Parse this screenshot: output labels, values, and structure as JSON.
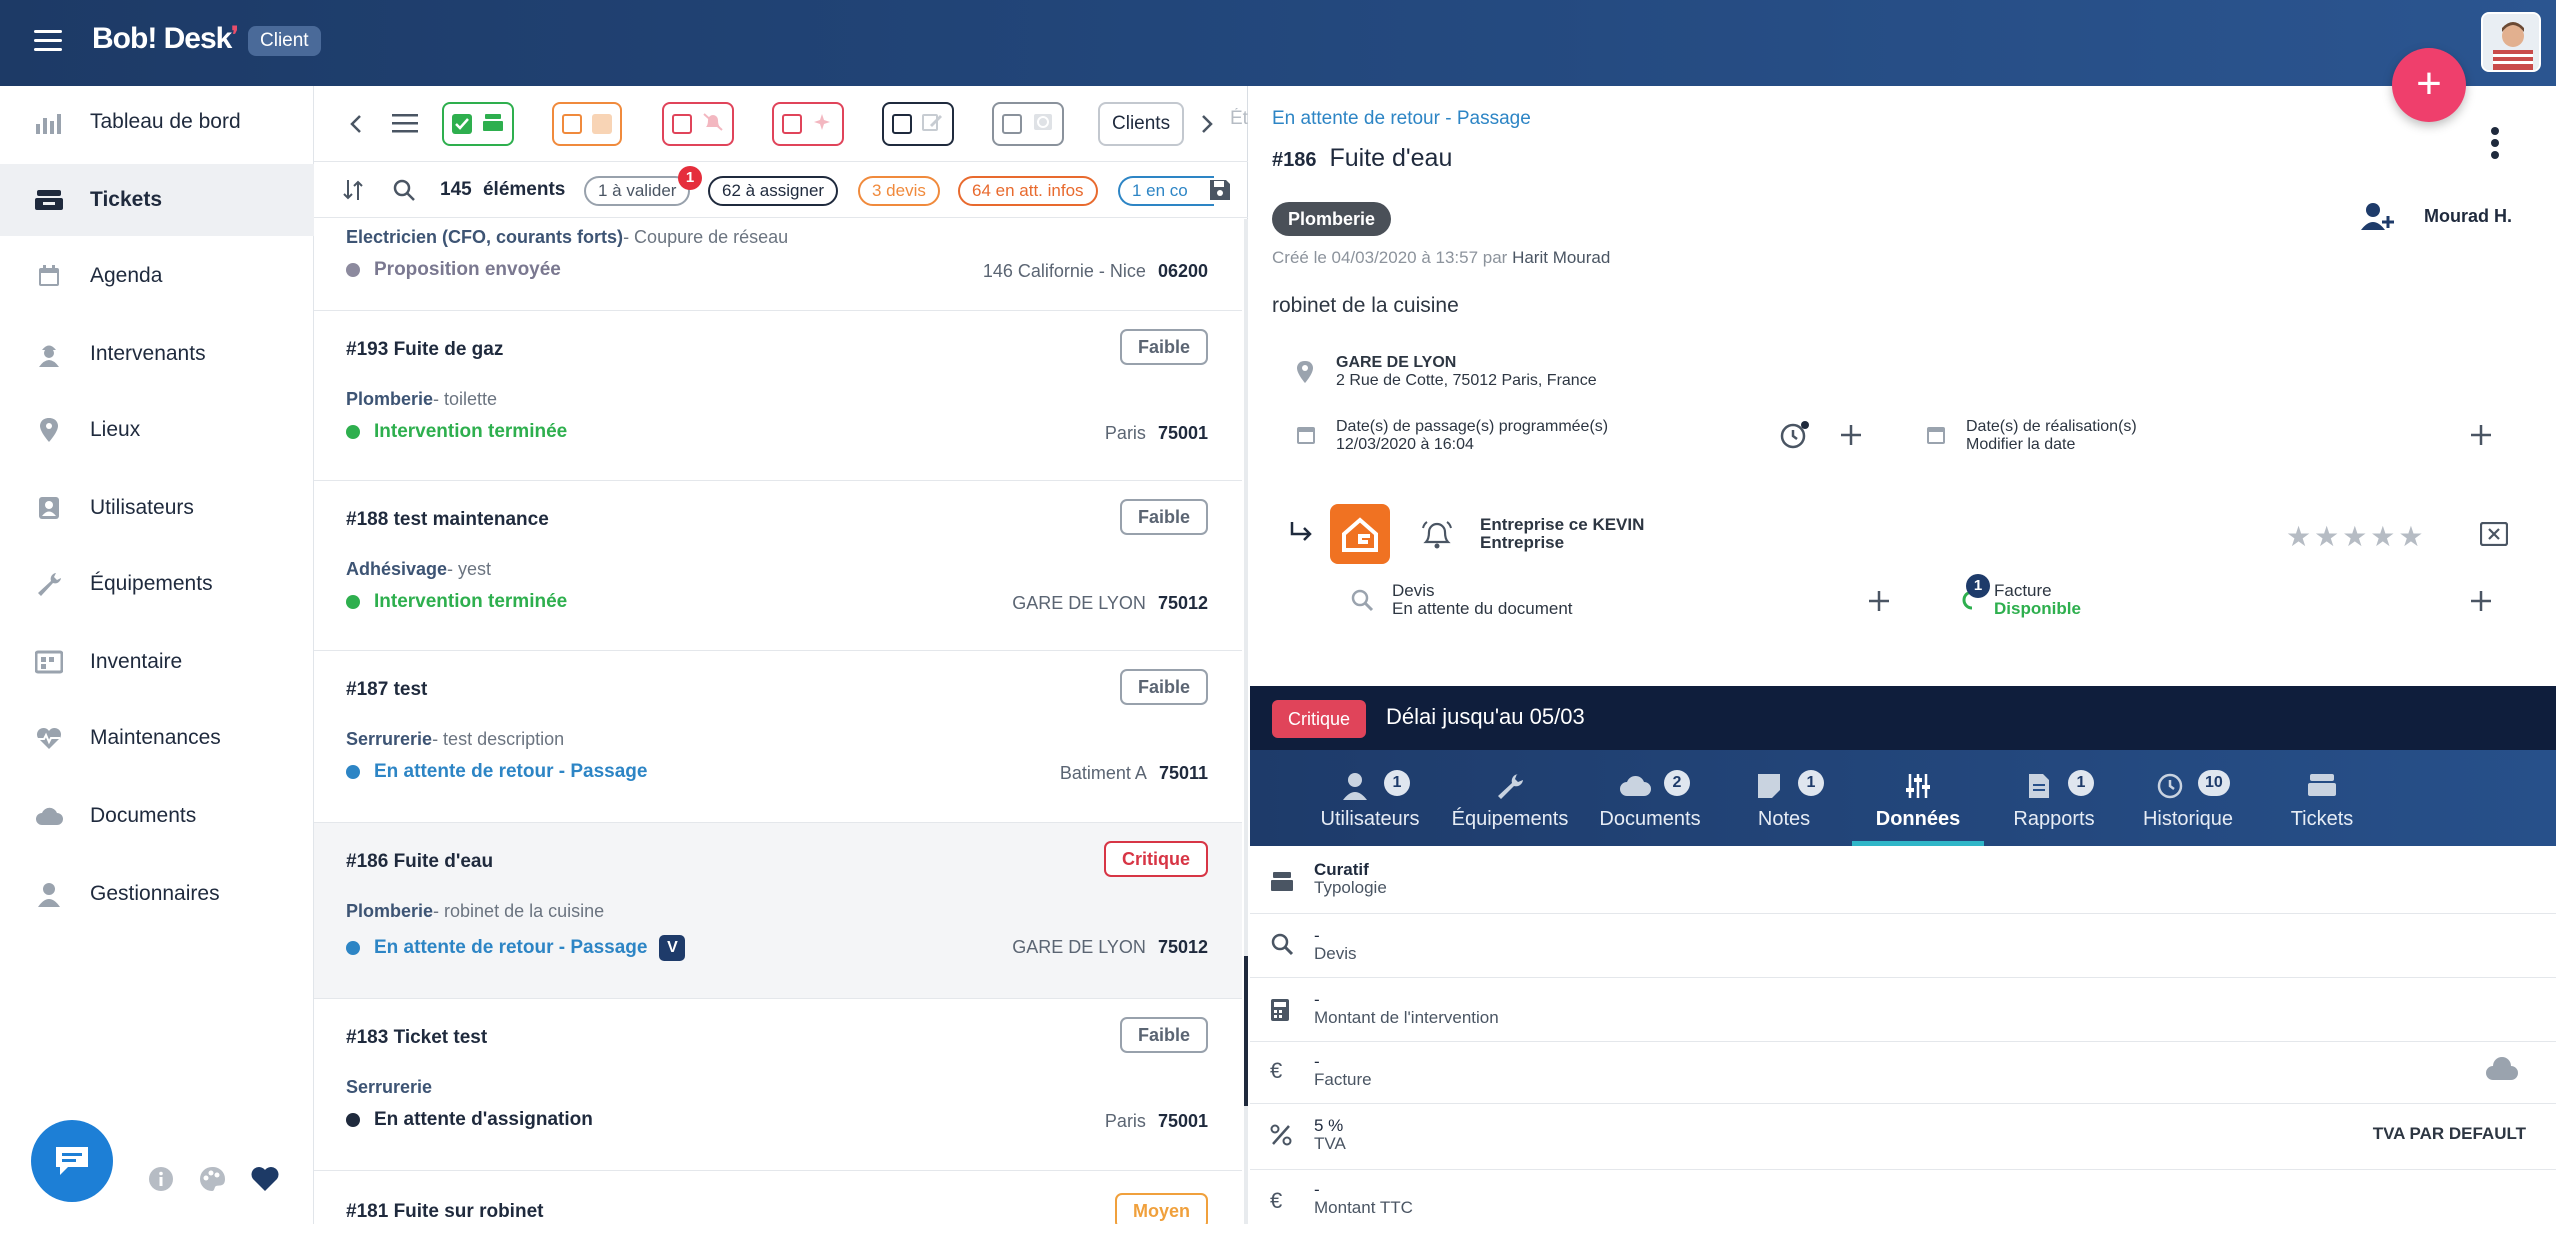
{
  "header": {
    "logo_text": "Bob! Desk",
    "badge": "Client"
  },
  "sidebar": {
    "items": [
      {
        "label": "Tableau de bord",
        "icon": "chart-bar-icon"
      },
      {
        "label": "Tickets",
        "icon": "tray-icon",
        "active": true
      },
      {
        "label": "Agenda",
        "icon": "calendar-icon"
      },
      {
        "label": "Intervenants",
        "icon": "worker-icon"
      },
      {
        "label": "Lieux",
        "icon": "location-pin-icon"
      },
      {
        "label": "Utilisateurs",
        "icon": "users-icon"
      },
      {
        "label": "Équipements",
        "icon": "wrench-icon"
      },
      {
        "label": "Inventaire",
        "icon": "inventory-icon"
      },
      {
        "label": "Maintenances",
        "icon": "heartbeat-icon"
      },
      {
        "label": "Documents",
        "icon": "cloud-icon"
      },
      {
        "label": "Gestionnaires",
        "icon": "manager-icon"
      }
    ]
  },
  "filters": {
    "clients_label": "Clients",
    "overflow_label": "Ét"
  },
  "summary": {
    "count": "145",
    "count_label": "éléments",
    "pills": [
      {
        "label": "1 à valider",
        "badge": "1"
      },
      {
        "label": "62 à assigner"
      },
      {
        "label": "3 devis"
      },
      {
        "label": "64 en att. infos"
      },
      {
        "label": "1 en co"
      }
    ]
  },
  "tickets": [
    {
      "cat": "Electricien (CFO, courants forts)",
      "desc": "- Coupure de réseau",
      "status": "Proposition envoyée",
      "status_color": "#8c8a9e",
      "place": "146 Californie - Nice",
      "zip": "06200"
    },
    {
      "num": "#193",
      "title": "Fuite de gaz",
      "priority": "Faible",
      "cat": "Plomberie",
      "desc": "- toilette",
      "status": "Intervention terminée",
      "status_color": "#2eaf4e",
      "place": "Paris",
      "zip": "75001"
    },
    {
      "num": "#188",
      "title": "test maintenance",
      "priority": "Faible",
      "cat": "Adhésivage",
      "desc": "- yest",
      "status": "Intervention terminée",
      "status_color": "#2eaf4e",
      "place": "GARE DE LYON",
      "zip": "75012"
    },
    {
      "num": "#187",
      "title": "test",
      "priority": "Faible",
      "cat": "Serrurerie",
      "desc": "- test description",
      "status": "En attente de retour - Passage",
      "status_color": "#2d85c5",
      "place": "Batiment A",
      "zip": "75011"
    },
    {
      "num": "#186",
      "title": "Fuite d'eau",
      "priority": "Critique",
      "cat": "Plomberie",
      "desc": "- robinet de la cuisine",
      "status": "En attente de retour - Passage",
      "status_color": "#2d85c5",
      "tag": "V",
      "place": "GARE DE LYON",
      "zip": "75012"
    },
    {
      "num": "#183",
      "title": "Ticket test",
      "priority": "Faible",
      "cat": "Serrurerie",
      "desc": "",
      "status": "En attente d'assignation",
      "status_color": "#1f2a3d",
      "place": "Paris",
      "zip": "75001"
    },
    {
      "num": "#181",
      "title": "Fuite sur robinet",
      "priority": "Moyen"
    }
  ],
  "detail": {
    "breadcrumb": "En attente de retour - Passage",
    "num": "#186",
    "title": "Fuite d'eau",
    "category": "Plomberie",
    "assignee": "Mourad H.",
    "created": "Créé le 04/03/2020 à 13:57 par",
    "created_by": "Harit Mourad",
    "description": "robinet de la cuisine",
    "place_name": "GARE DE LYON",
    "place_addr": "2 Rue de Cotte, 75012 Paris, France",
    "dates_label": "Date(s) de passage(s) programmée(s)",
    "dates_value": "12/03/2020 à 16:04",
    "real_label": "Date(s) de réalisation(s)",
    "real_value": "Modifier la date",
    "company": "Entreprise ce KEVIN",
    "company_type": "Entreprise",
    "devis_label": "Devis",
    "devis_value": "En attente du document",
    "facture_label": "Facture",
    "facture_value": "Disponible",
    "facture_badge": "1",
    "critique": "Critique",
    "delay": "Délai jusqu'au 05/03",
    "tabs": [
      {
        "label": "Utilisateurs",
        "count": "1",
        "icon": "user-icon"
      },
      {
        "label": "Équipements",
        "icon": "wrench-icon"
      },
      {
        "label": "Documents",
        "count": "2",
        "icon": "cloud-icon"
      },
      {
        "label": "Notes",
        "count": "1",
        "icon": "note-icon"
      },
      {
        "label": "Données",
        "active": true,
        "icon": "sliders-icon"
      },
      {
        "label": "Rapports",
        "count": "1",
        "icon": "report-icon"
      },
      {
        "label": "Historique",
        "count": "10",
        "icon": "history-icon"
      },
      {
        "label": "Tickets",
        "icon": "tray-icon"
      }
    ],
    "rows": [
      {
        "v1": "Curatif",
        "v2": "Typologie",
        "icon": "tray-icon"
      },
      {
        "v1": "-",
        "v2": "Devis",
        "icon": "search-money-icon"
      },
      {
        "v1": "-",
        "v2": "Montant de l'intervention",
        "icon": "calculator-icon"
      },
      {
        "v1": "-",
        "v2": "Facture",
        "icon": "euro-icon"
      },
      {
        "v1": "5 %",
        "v2": "TVA",
        "icon": "percent-icon",
        "right": "TVA PAR DEFAULT"
      },
      {
        "v1": "-",
        "v2": "Montant TTC",
        "icon": "euro-icon"
      }
    ]
  },
  "colors": {
    "accent": "#ef3f6c",
    "header": "#1d3a66",
    "critical": "#d73545",
    "active_tab": "#2fb6c8"
  }
}
